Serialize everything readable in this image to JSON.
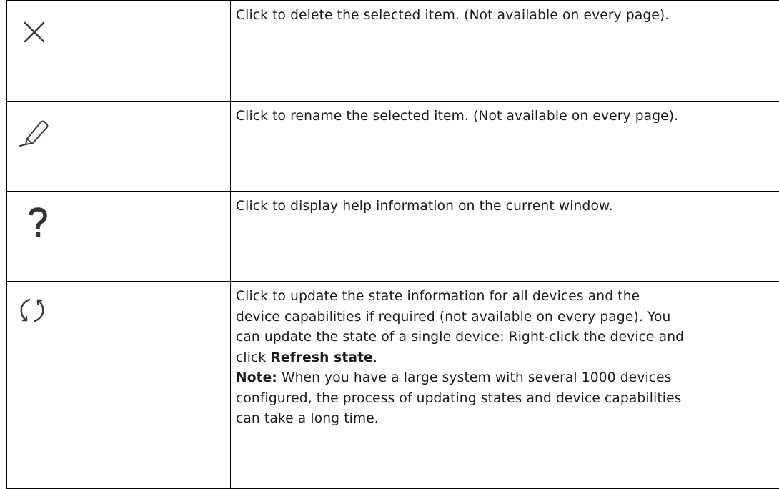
{
  "rows": [
    {
      "icon": "close-icon",
      "lines": [
        "Click to delete the selected item. (Not available on every page)."
      ]
    },
    {
      "icon": "pencil-icon",
      "lines": [
        "Click to rename the selected item. (Not available on every page)."
      ]
    },
    {
      "icon": "help-icon",
      "lines": [
        "Click to display help information on the current window."
      ]
    },
    {
      "icon": "refresh-icon",
      "lines": [
        "Click to update the state information for all devices and the",
        "device capabilities if required (not available on every page). You",
        "can update the state of a single device: Right-click the device and"
      ],
      "line4_prefix": "click ",
      "line4_bold": "Refresh state",
      "line4_suffix": ".",
      "note_label": "Note:",
      "note_line1": " When you have a large system with several 1000 devices",
      "note_line2": "configured, the process of updating states and device capabilities",
      "note_line3": "can take a long time."
    }
  ]
}
